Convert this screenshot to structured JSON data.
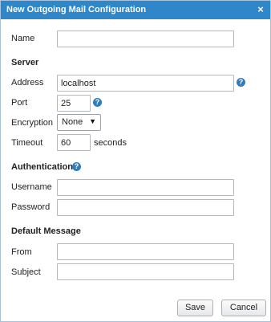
{
  "dialog": {
    "title": "New Outgoing Mail Configuration",
    "close_glyph": "×"
  },
  "name": {
    "label": "Name",
    "value": ""
  },
  "server": {
    "heading": "Server",
    "address": {
      "label": "Address",
      "value": "localhost",
      "help_icon": "help-circle-icon"
    },
    "port": {
      "label": "Port",
      "value": "25",
      "help_icon": "help-circle-icon"
    },
    "encryption": {
      "label": "Encryption",
      "selected": "None",
      "arrow_glyph": "▼"
    },
    "timeout": {
      "label": "Timeout",
      "value": "60",
      "unit": "seconds"
    }
  },
  "authentication": {
    "heading": "Authentication",
    "help_icon": "help-circle-icon",
    "username": {
      "label": "Username",
      "value": ""
    },
    "password": {
      "label": "Password",
      "value": ""
    }
  },
  "default_message": {
    "heading": "Default Message",
    "from": {
      "label": "From",
      "value": ""
    },
    "subject": {
      "label": "Subject",
      "value": ""
    }
  },
  "buttons": {
    "save": "Save",
    "cancel": "Cancel"
  },
  "help_glyph": "?",
  "colors": {
    "titlebar": "#2f86c8",
    "help_icon": "#2f7dc0"
  }
}
